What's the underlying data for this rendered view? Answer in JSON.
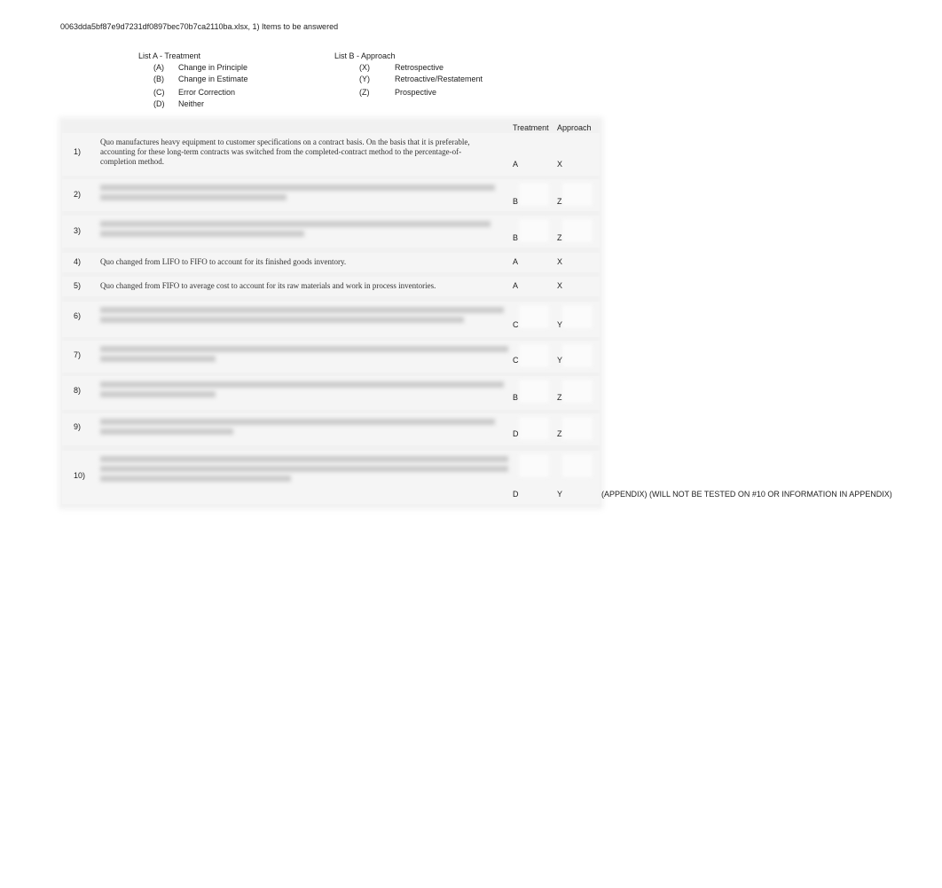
{
  "header": {
    "title": "0063dda5bf87e9d7231df0897bec70b7ca2110ba.xlsx, 1) Items to be answered"
  },
  "list_a": {
    "heading": "List A - Treatment",
    "items": [
      {
        "code": "(A)",
        "label": "Change in Principle"
      },
      {
        "code": "(B)",
        "label": "Change in Estimate"
      },
      {
        "code": "(C)",
        "label": "Error Correction"
      },
      {
        "code": "(D)",
        "label": "Neither"
      }
    ]
  },
  "list_b": {
    "heading": "List B - Approach",
    "items": [
      {
        "code": "(X)",
        "label": "Retrospective"
      },
      {
        "code": "(Y)",
        "label": "Retroactive/Restatement"
      },
      {
        "code": "(Z)",
        "label": "Prospective"
      }
    ]
  },
  "table": {
    "columns": {
      "treatment": "Treatment",
      "approach": "Approach"
    },
    "rows": [
      {
        "num": "1)",
        "text": "Quo manufactures heavy equipment to customer specifications on a contract basis. On the basis that it is preferable, accounting for these long-term contracts was switched from the completed-contract method to the percentage-of-completion method.",
        "treatment": "A",
        "approach": "X",
        "blurred": false
      },
      {
        "num": "2)",
        "text": "",
        "treatment": "B",
        "approach": "Z",
        "blurred": true
      },
      {
        "num": "3)",
        "text": "",
        "treatment": "B",
        "approach": "Z",
        "blurred": true
      },
      {
        "num": "4)",
        "text": "Quo changed from LIFO to FIFO to account for its finished goods inventory.",
        "treatment": "A",
        "approach": "X",
        "blurred": false
      },
      {
        "num": "5)",
        "text": "Quo changed from FIFO to average cost to account for its raw materials and work in process inventories.",
        "treatment": "A",
        "approach": "X",
        "blurred": false
      },
      {
        "num": "6)",
        "text": "",
        "treatment": "C",
        "approach": "Y",
        "blurred": true
      },
      {
        "num": "7)",
        "text": "",
        "treatment": "C",
        "approach": "Y",
        "blurred": true
      },
      {
        "num": "8)",
        "text": "",
        "treatment": "B",
        "approach": "Z",
        "blurred": true
      },
      {
        "num": "9)",
        "text": "",
        "treatment": "D",
        "approach": "Z",
        "blurred": true
      },
      {
        "num": "10)",
        "text": "",
        "treatment": "D",
        "approach": "Y",
        "blurred": true
      }
    ],
    "note": "(APPENDIX) (WILL NOT BE TESTED ON #10 OR INFORMATION IN APPENDIX)"
  }
}
